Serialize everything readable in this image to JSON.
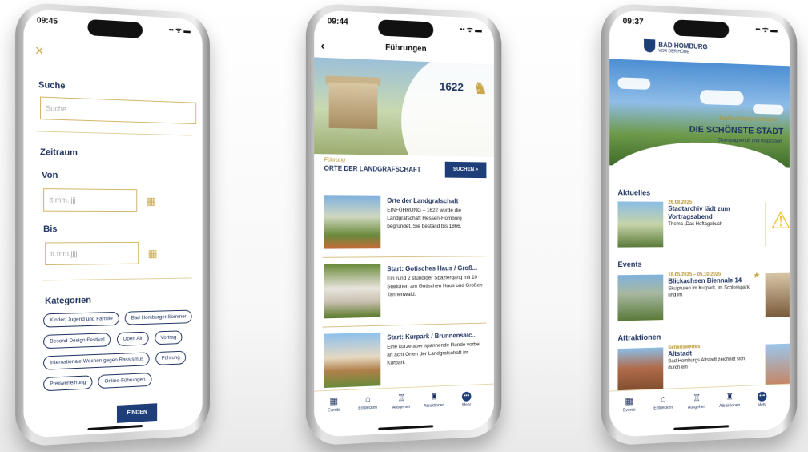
{
  "phone1": {
    "time": "09:45",
    "signal": "▪▪ ᯤ ▬",
    "close_icon": "×",
    "search_label": "Suche",
    "search_placeholder": "Suche",
    "zeitraum_label": "Zeitraum",
    "von_label": "Von",
    "von_placeholder": "tt.mm.jjjj",
    "bis_label": "Bis",
    "bis_placeholder": "tt.mm.jjjj",
    "kategorien_label": "Kategorien",
    "chips": [
      "Kinder, Jugend und Familie",
      "Bad Homburger Sommer",
      "Besond Design Festival",
      "Open Air",
      "Vortrag",
      "Internationale Wochen gegen Rassismus",
      "Führung",
      "Preisverleihung",
      "Online-Führungen"
    ],
    "find_button": "FINDEN"
  },
  "phone2": {
    "time": "09:44",
    "signal": "▪▪ ᯤ ▬",
    "title": "Führungen",
    "logo_text": "1622",
    "hero_kicker": "Führung",
    "hero_title": "ORTE DER LANDGRAFSCHAFT",
    "search_button": "SUCHEN ⌕",
    "items": [
      {
        "title": "Orte der Landgrafschaft",
        "desc": "EINFÜHRUNG – 1622 wurde die Landgrafschaft Hessen-Homburg begründet. Sie bestand bis 1866."
      },
      {
        "title": "Start: Gotisches Haus / Groß...",
        "desc": "Ein rund 2 stündiger Spaziergang mit 10 Stationen am Gotischen Haus und Großen Tannenwald."
      },
      {
        "title": "Start: Kurpark / Brunnensälc...",
        "desc": "Eine kurze aber spannende Runde vorbei an acht Orten der Landgrafschaft im Kurpark"
      }
    ],
    "tabs": [
      "Events",
      "Entdecken",
      "Ausgehen",
      "Attraktionen",
      "Mehr"
    ]
  },
  "phone3": {
    "time": "09:37",
    "signal": "▪▪ ᯤ ▬",
    "brand": "BAD HOMBURG",
    "brand_sub": "VOR DER HÖHE",
    "hero_kicker": "Bad Homburg entdecken",
    "hero_title": "DIE SCHÖNSTE STADT",
    "hero_sub": "Champagnerluft und Inspiration",
    "sections": {
      "aktuelles": "Aktuelles",
      "events": "Events",
      "attraktionen": "Attraktionen"
    },
    "aktuelles_card": {
      "date": "26.08.2025",
      "title": "Stadtarchiv lädt zum Vortragsabend",
      "desc": "Thema „Das Hoftagebuch"
    },
    "events_card": {
      "date": "18.05.2025 – 05.10.2025",
      "title": "Blickachsen Biennale 14",
      "desc": "Skulpturen im Kurpark, im Schlosspark und im"
    },
    "attraktion_card": {
      "date": "Sehenswertes",
      "title": "Altstadt",
      "desc": "Bad Homburgs Altstadt zeichnet sich durch ein"
    },
    "tabs": [
      "Events",
      "Entdecken",
      "Ausgehen",
      "Attraktionen",
      "Mehr"
    ]
  }
}
